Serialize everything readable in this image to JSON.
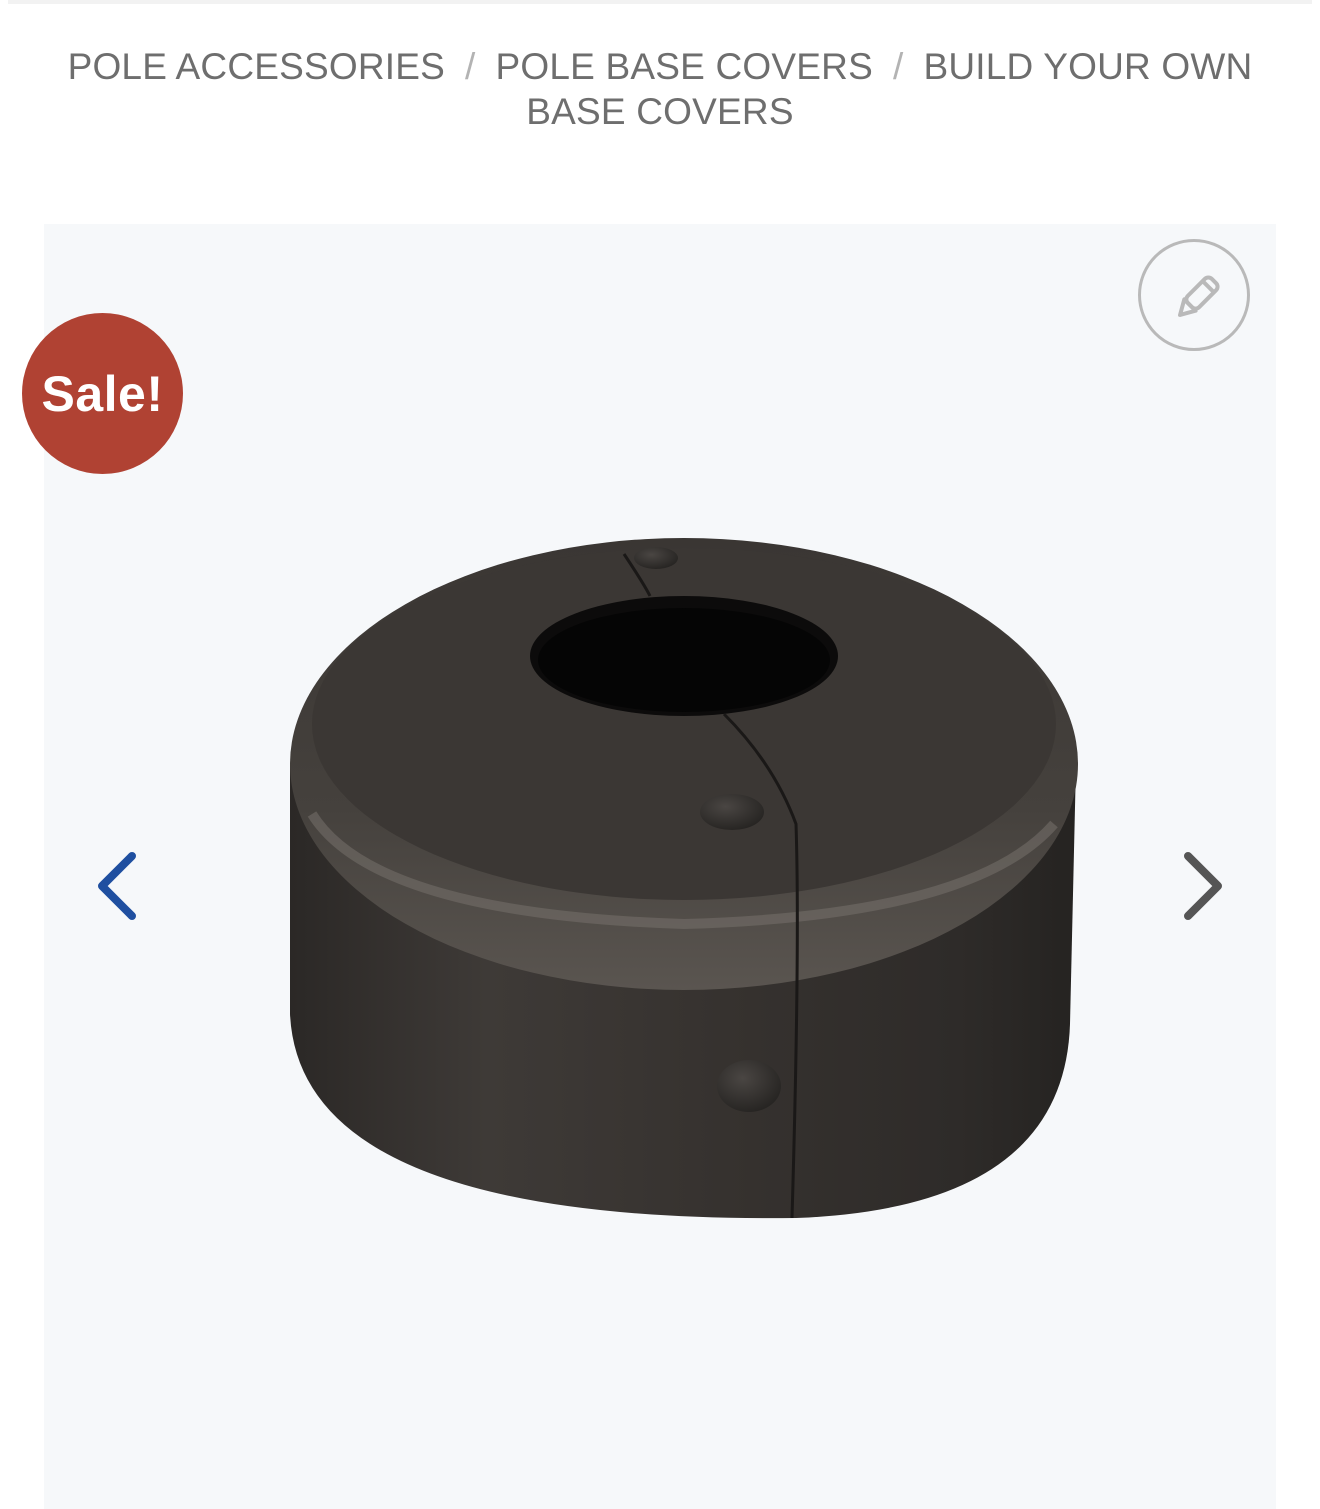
{
  "breadcrumb": {
    "items": [
      {
        "label": "POLE ACCESSORIES"
      },
      {
        "label": "POLE BASE COVERS"
      },
      {
        "label": "BUILD YOUR OWN BASE COVERS"
      }
    ],
    "separator": "/"
  },
  "product": {
    "badge": "Sale!",
    "image_icon": "base-cover-product-photo",
    "edit_icon": "pencil-icon",
    "prev_icon": "chevron-left-icon",
    "next_icon": "chevron-right-icon"
  },
  "colors": {
    "badge_bg": "#b04233",
    "prev_arrow": "#1f4fa0",
    "next_arrow": "#555555",
    "breadcrumb_text": "#6e6e6e"
  }
}
